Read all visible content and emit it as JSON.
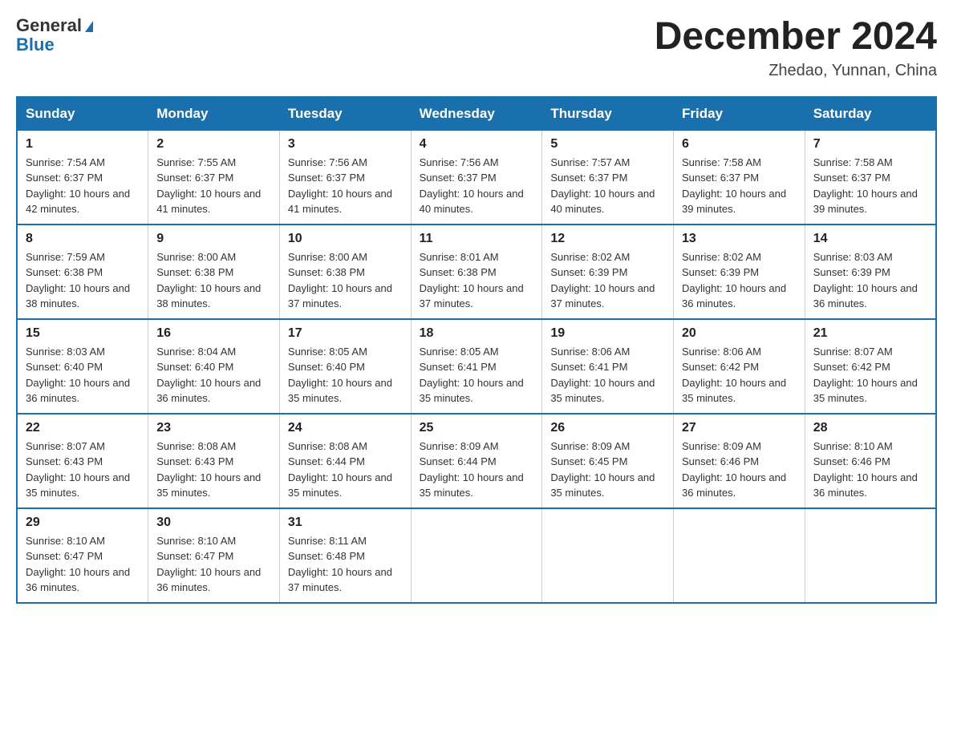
{
  "logo": {
    "general": "General",
    "blue": "Blue"
  },
  "title": "December 2024",
  "location": "Zhedao, Yunnan, China",
  "headers": [
    "Sunday",
    "Monday",
    "Tuesday",
    "Wednesday",
    "Thursday",
    "Friday",
    "Saturday"
  ],
  "weeks": [
    [
      {
        "day": "1",
        "sunrise": "7:54 AM",
        "sunset": "6:37 PM",
        "daylight": "10 hours and 42 minutes."
      },
      {
        "day": "2",
        "sunrise": "7:55 AM",
        "sunset": "6:37 PM",
        "daylight": "10 hours and 41 minutes."
      },
      {
        "day": "3",
        "sunrise": "7:56 AM",
        "sunset": "6:37 PM",
        "daylight": "10 hours and 41 minutes."
      },
      {
        "day": "4",
        "sunrise": "7:56 AM",
        "sunset": "6:37 PM",
        "daylight": "10 hours and 40 minutes."
      },
      {
        "day": "5",
        "sunrise": "7:57 AM",
        "sunset": "6:37 PM",
        "daylight": "10 hours and 40 minutes."
      },
      {
        "day": "6",
        "sunrise": "7:58 AM",
        "sunset": "6:37 PM",
        "daylight": "10 hours and 39 minutes."
      },
      {
        "day": "7",
        "sunrise": "7:58 AM",
        "sunset": "6:37 PM",
        "daylight": "10 hours and 39 minutes."
      }
    ],
    [
      {
        "day": "8",
        "sunrise": "7:59 AM",
        "sunset": "6:38 PM",
        "daylight": "10 hours and 38 minutes."
      },
      {
        "day": "9",
        "sunrise": "8:00 AM",
        "sunset": "6:38 PM",
        "daylight": "10 hours and 38 minutes."
      },
      {
        "day": "10",
        "sunrise": "8:00 AM",
        "sunset": "6:38 PM",
        "daylight": "10 hours and 37 minutes."
      },
      {
        "day": "11",
        "sunrise": "8:01 AM",
        "sunset": "6:38 PM",
        "daylight": "10 hours and 37 minutes."
      },
      {
        "day": "12",
        "sunrise": "8:02 AM",
        "sunset": "6:39 PM",
        "daylight": "10 hours and 37 minutes."
      },
      {
        "day": "13",
        "sunrise": "8:02 AM",
        "sunset": "6:39 PM",
        "daylight": "10 hours and 36 minutes."
      },
      {
        "day": "14",
        "sunrise": "8:03 AM",
        "sunset": "6:39 PM",
        "daylight": "10 hours and 36 minutes."
      }
    ],
    [
      {
        "day": "15",
        "sunrise": "8:03 AM",
        "sunset": "6:40 PM",
        "daylight": "10 hours and 36 minutes."
      },
      {
        "day": "16",
        "sunrise": "8:04 AM",
        "sunset": "6:40 PM",
        "daylight": "10 hours and 36 minutes."
      },
      {
        "day": "17",
        "sunrise": "8:05 AM",
        "sunset": "6:40 PM",
        "daylight": "10 hours and 35 minutes."
      },
      {
        "day": "18",
        "sunrise": "8:05 AM",
        "sunset": "6:41 PM",
        "daylight": "10 hours and 35 minutes."
      },
      {
        "day": "19",
        "sunrise": "8:06 AM",
        "sunset": "6:41 PM",
        "daylight": "10 hours and 35 minutes."
      },
      {
        "day": "20",
        "sunrise": "8:06 AM",
        "sunset": "6:42 PM",
        "daylight": "10 hours and 35 minutes."
      },
      {
        "day": "21",
        "sunrise": "8:07 AM",
        "sunset": "6:42 PM",
        "daylight": "10 hours and 35 minutes."
      }
    ],
    [
      {
        "day": "22",
        "sunrise": "8:07 AM",
        "sunset": "6:43 PM",
        "daylight": "10 hours and 35 minutes."
      },
      {
        "day": "23",
        "sunrise": "8:08 AM",
        "sunset": "6:43 PM",
        "daylight": "10 hours and 35 minutes."
      },
      {
        "day": "24",
        "sunrise": "8:08 AM",
        "sunset": "6:44 PM",
        "daylight": "10 hours and 35 minutes."
      },
      {
        "day": "25",
        "sunrise": "8:09 AM",
        "sunset": "6:44 PM",
        "daylight": "10 hours and 35 minutes."
      },
      {
        "day": "26",
        "sunrise": "8:09 AM",
        "sunset": "6:45 PM",
        "daylight": "10 hours and 35 minutes."
      },
      {
        "day": "27",
        "sunrise": "8:09 AM",
        "sunset": "6:46 PM",
        "daylight": "10 hours and 36 minutes."
      },
      {
        "day": "28",
        "sunrise": "8:10 AM",
        "sunset": "6:46 PM",
        "daylight": "10 hours and 36 minutes."
      }
    ],
    [
      {
        "day": "29",
        "sunrise": "8:10 AM",
        "sunset": "6:47 PM",
        "daylight": "10 hours and 36 minutes."
      },
      {
        "day": "30",
        "sunrise": "8:10 AM",
        "sunset": "6:47 PM",
        "daylight": "10 hours and 36 minutes."
      },
      {
        "day": "31",
        "sunrise": "8:11 AM",
        "sunset": "6:48 PM",
        "daylight": "10 hours and 37 minutes."
      },
      null,
      null,
      null,
      null
    ]
  ],
  "labels": {
    "sunrise_prefix": "Sunrise: ",
    "sunset_prefix": "Sunset: ",
    "daylight_prefix": "Daylight: "
  }
}
